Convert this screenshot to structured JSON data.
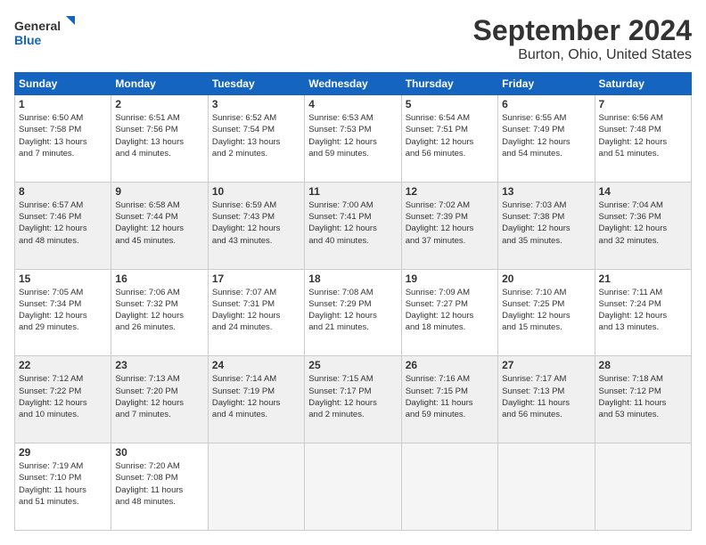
{
  "logo": {
    "line1": "General",
    "line2": "Blue"
  },
  "title": "September 2024",
  "subtitle": "Burton, Ohio, United States",
  "days_of_week": [
    "Sunday",
    "Monday",
    "Tuesday",
    "Wednesday",
    "Thursday",
    "Friday",
    "Saturday"
  ],
  "weeks": [
    {
      "shaded": false,
      "days": [
        {
          "num": "1",
          "info": "Sunrise: 6:50 AM\nSunset: 7:58 PM\nDaylight: 13 hours\nand 7 minutes."
        },
        {
          "num": "2",
          "info": "Sunrise: 6:51 AM\nSunset: 7:56 PM\nDaylight: 13 hours\nand 4 minutes."
        },
        {
          "num": "3",
          "info": "Sunrise: 6:52 AM\nSunset: 7:54 PM\nDaylight: 13 hours\nand 2 minutes."
        },
        {
          "num": "4",
          "info": "Sunrise: 6:53 AM\nSunset: 7:53 PM\nDaylight: 12 hours\nand 59 minutes."
        },
        {
          "num": "5",
          "info": "Sunrise: 6:54 AM\nSunset: 7:51 PM\nDaylight: 12 hours\nand 56 minutes."
        },
        {
          "num": "6",
          "info": "Sunrise: 6:55 AM\nSunset: 7:49 PM\nDaylight: 12 hours\nand 54 minutes."
        },
        {
          "num": "7",
          "info": "Sunrise: 6:56 AM\nSunset: 7:48 PM\nDaylight: 12 hours\nand 51 minutes."
        }
      ]
    },
    {
      "shaded": true,
      "days": [
        {
          "num": "8",
          "info": "Sunrise: 6:57 AM\nSunset: 7:46 PM\nDaylight: 12 hours\nand 48 minutes."
        },
        {
          "num": "9",
          "info": "Sunrise: 6:58 AM\nSunset: 7:44 PM\nDaylight: 12 hours\nand 45 minutes."
        },
        {
          "num": "10",
          "info": "Sunrise: 6:59 AM\nSunset: 7:43 PM\nDaylight: 12 hours\nand 43 minutes."
        },
        {
          "num": "11",
          "info": "Sunrise: 7:00 AM\nSunset: 7:41 PM\nDaylight: 12 hours\nand 40 minutes."
        },
        {
          "num": "12",
          "info": "Sunrise: 7:02 AM\nSunset: 7:39 PM\nDaylight: 12 hours\nand 37 minutes."
        },
        {
          "num": "13",
          "info": "Sunrise: 7:03 AM\nSunset: 7:38 PM\nDaylight: 12 hours\nand 35 minutes."
        },
        {
          "num": "14",
          "info": "Sunrise: 7:04 AM\nSunset: 7:36 PM\nDaylight: 12 hours\nand 32 minutes."
        }
      ]
    },
    {
      "shaded": false,
      "days": [
        {
          "num": "15",
          "info": "Sunrise: 7:05 AM\nSunset: 7:34 PM\nDaylight: 12 hours\nand 29 minutes."
        },
        {
          "num": "16",
          "info": "Sunrise: 7:06 AM\nSunset: 7:32 PM\nDaylight: 12 hours\nand 26 minutes."
        },
        {
          "num": "17",
          "info": "Sunrise: 7:07 AM\nSunset: 7:31 PM\nDaylight: 12 hours\nand 24 minutes."
        },
        {
          "num": "18",
          "info": "Sunrise: 7:08 AM\nSunset: 7:29 PM\nDaylight: 12 hours\nand 21 minutes."
        },
        {
          "num": "19",
          "info": "Sunrise: 7:09 AM\nSunset: 7:27 PM\nDaylight: 12 hours\nand 18 minutes."
        },
        {
          "num": "20",
          "info": "Sunrise: 7:10 AM\nSunset: 7:25 PM\nDaylight: 12 hours\nand 15 minutes."
        },
        {
          "num": "21",
          "info": "Sunrise: 7:11 AM\nSunset: 7:24 PM\nDaylight: 12 hours\nand 13 minutes."
        }
      ]
    },
    {
      "shaded": true,
      "days": [
        {
          "num": "22",
          "info": "Sunrise: 7:12 AM\nSunset: 7:22 PM\nDaylight: 12 hours\nand 10 minutes."
        },
        {
          "num": "23",
          "info": "Sunrise: 7:13 AM\nSunset: 7:20 PM\nDaylight: 12 hours\nand 7 minutes."
        },
        {
          "num": "24",
          "info": "Sunrise: 7:14 AM\nSunset: 7:19 PM\nDaylight: 12 hours\nand 4 minutes."
        },
        {
          "num": "25",
          "info": "Sunrise: 7:15 AM\nSunset: 7:17 PM\nDaylight: 12 hours\nand 2 minutes."
        },
        {
          "num": "26",
          "info": "Sunrise: 7:16 AM\nSunset: 7:15 PM\nDaylight: 11 hours\nand 59 minutes."
        },
        {
          "num": "27",
          "info": "Sunrise: 7:17 AM\nSunset: 7:13 PM\nDaylight: 11 hours\nand 56 minutes."
        },
        {
          "num": "28",
          "info": "Sunrise: 7:18 AM\nSunset: 7:12 PM\nDaylight: 11 hours\nand 53 minutes."
        }
      ]
    },
    {
      "shaded": false,
      "days": [
        {
          "num": "29",
          "info": "Sunrise: 7:19 AM\nSunset: 7:10 PM\nDaylight: 11 hours\nand 51 minutes."
        },
        {
          "num": "30",
          "info": "Sunrise: 7:20 AM\nSunset: 7:08 PM\nDaylight: 11 hours\nand 48 minutes."
        },
        {
          "num": "",
          "info": ""
        },
        {
          "num": "",
          "info": ""
        },
        {
          "num": "",
          "info": ""
        },
        {
          "num": "",
          "info": ""
        },
        {
          "num": "",
          "info": ""
        }
      ]
    }
  ]
}
